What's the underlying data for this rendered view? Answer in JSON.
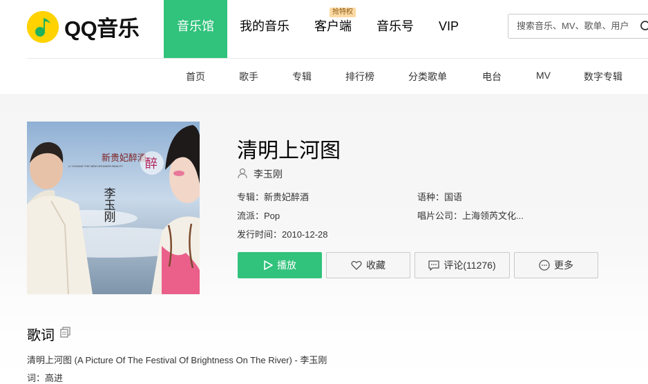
{
  "header": {
    "logo_text": "QQ音乐",
    "nav": [
      {
        "label": "音乐馆",
        "active": true
      },
      {
        "label": "我的音乐",
        "active": false
      },
      {
        "label": "客户端",
        "active": false,
        "badge": "抢特权"
      },
      {
        "label": "音乐号",
        "active": false
      },
      {
        "label": "VIP",
        "active": false
      }
    ],
    "search_placeholder": "搜索音乐、MV、歌单、用户"
  },
  "subnav": [
    "首页",
    "歌手",
    "专辑",
    "排行榜",
    "分类歌单",
    "电台",
    "MV",
    "数字专辑"
  ],
  "cover": {
    "album_text": "新贵妃醉酒",
    "album_subtitle": "LI YUGANG THE NEW DRUNKEN BEAUTY",
    "artist_text": "李玉刚",
    "seal_text": "醉"
  },
  "song": {
    "title": "清明上河图",
    "singer": "李玉刚",
    "album_label": "专辑：新贵妃醉酒",
    "language_label": "语种：国语",
    "genre_label": "流派：Pop",
    "label_label": "唱片公司：上海领芮文化...",
    "release_label": "发行时间：2010-12-28"
  },
  "actions": {
    "play": "播放",
    "favorite": "收藏",
    "comment": "评论(11276)",
    "more": "更多"
  },
  "lyrics": {
    "heading": "歌词",
    "line1": "清明上河图 (A Picture Of The Festival Of Brightness On The River) - 李玉刚",
    "line2": "词：高进"
  },
  "colors": {
    "brand_green": "#31c27c",
    "logo_yellow": "#ffd200"
  },
  "icons": [
    "music-note-logo",
    "search-icon",
    "user-icon",
    "play-icon",
    "heart-icon",
    "comment-icon",
    "more-icon",
    "copy-icon"
  ]
}
